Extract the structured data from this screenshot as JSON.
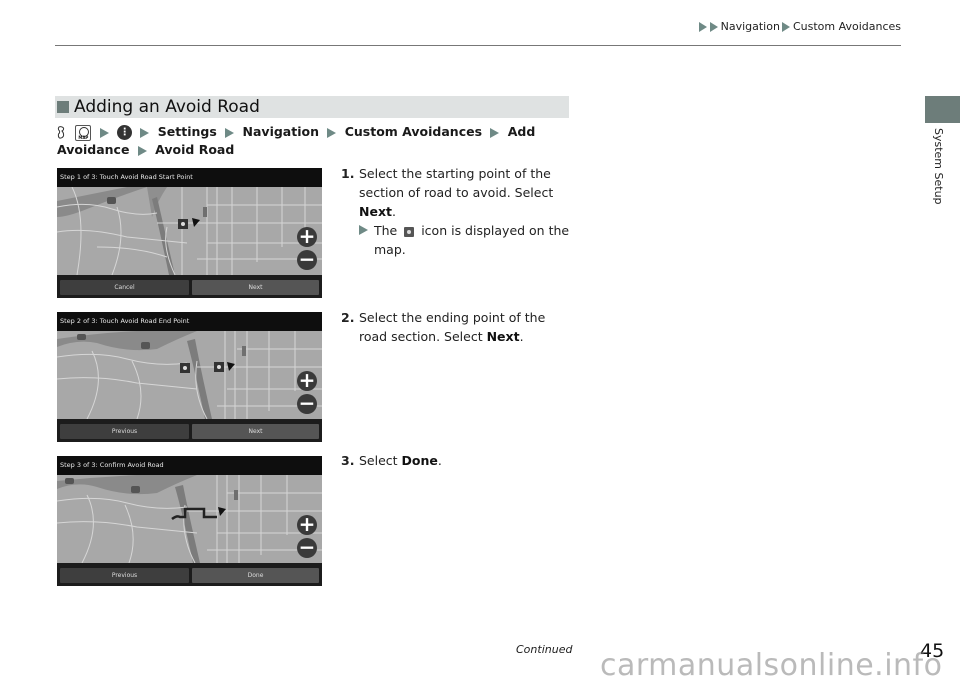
{
  "header": {
    "breadcrumb": [
      "Navigation",
      "Custom Avoidances"
    ]
  },
  "side_tab": {
    "label": "System Setup",
    "color": "#6d7d7a"
  },
  "section": {
    "title": "Adding an Avoid Road",
    "path": {
      "icons": [
        "voice-command-icon",
        "map-button-icon",
        "menu-icon"
      ],
      "map_icon_text": "MAP",
      "menu_icon_glyph": "⋮",
      "items": [
        "Settings",
        "Navigation",
        "Custom Avoidances",
        "Add Avoidance",
        "Avoid Road"
      ]
    }
  },
  "screens": [
    {
      "title": "Step 1 of 3: Touch Avoid Road Start Point",
      "left_button": "Cancel",
      "right_button": "Next",
      "zoom_in": "+",
      "zoom_out": "−"
    },
    {
      "title": "Step 2 of 3: Touch Avoid Road End Point",
      "left_button": "Previous",
      "right_button": "Next",
      "zoom_in": "+",
      "zoom_out": "−"
    },
    {
      "title": "Step 3 of 3: Confirm Avoid Road",
      "left_button": "Previous",
      "right_button": "Done",
      "zoom_in": "+",
      "zoom_out": "−"
    }
  ],
  "steps": [
    {
      "number": "1.",
      "text_before": "Select the starting point of the section of road to avoid. Select ",
      "bold": "Next",
      "text_after": ".",
      "sub": {
        "before": "The ",
        "after": " icon is displayed on the map."
      }
    },
    {
      "number": "2.",
      "text_before": "Select the ending point of the road section. Select ",
      "bold": "Next",
      "text_after": "."
    },
    {
      "number": "3.",
      "text_before": "Select ",
      "bold": "Done",
      "text_after": "."
    }
  ],
  "footer": {
    "continued": "Continued",
    "page_number": "45",
    "watermark": "carmanualsonline.info"
  }
}
